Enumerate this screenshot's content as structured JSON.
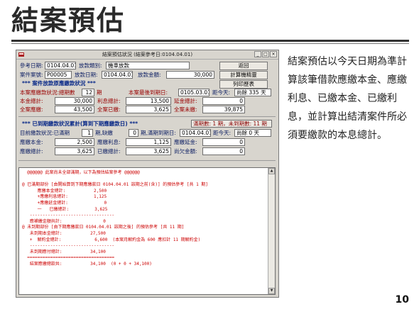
{
  "slide": {
    "title": "結案預估",
    "description": "結案預估以今天日期為準計算該筆借款應繳本金、應繳利息、已繳本金、已繳利息，並計算出結清案件所必須要繳款的本息總計。",
    "page_number": "10"
  },
  "window": {
    "title": "結案預估狀況 (結案參考日:0104.04.01)",
    "icon": "app-icon",
    "controls": [
      "_",
      "□",
      "×"
    ]
  },
  "form": {
    "ref_date_label": "參考日期:",
    "ref_date": "0104.04.01",
    "loan_type_label": "放款類別:",
    "loan_type": "機車放款",
    "case_no_label": "案件案號:",
    "case_no": "P00005",
    "loan_date_label": "放款日期:",
    "loan_date": "0104.04.01",
    "loan_amount_label": "放款金額:",
    "loan_amount": "30,000",
    "buttons": {
      "back": "返回",
      "calc_table": "計算機精靈",
      "print_detail": "列印歷表"
    },
    "sec1_title": "*** 案件放款原應繳款狀況 ***",
    "periods_label": "本案應繳款狀況:總期數",
    "periods": "12",
    "periods_unit": "期",
    "last_due_label": "本案最後到期日:",
    "last_due": "0105.03.01",
    "distance_label": "距今天:",
    "distance": "尚餘 335 天",
    "principal_total_label": "本金總計:",
    "principal_total": "30,000",
    "interest_total_label": "利息總計:",
    "interest_total": "13,500",
    "late_fee_total_label": "延金總計:",
    "late_fee_total": "0",
    "all_due_label": "全案應繳:",
    "all_due": "43,500",
    "all_paid_label": "全案已繳:",
    "all_paid": "3,625",
    "all_unpaid_label": "全案未繳:",
    "all_unpaid": "39,875",
    "sec2_title": "*** 已到期繳款狀況累計(算到下期應繳款日) ***",
    "sec2_status": "滿期數: 1 期，未到期數: 11 期",
    "pay_status_label": "目前繳款狀況:已滿期",
    "pay_full": "1",
    "pay_full_unit": "期,缺繳",
    "pay_missing": "0",
    "pay_missing_unit": "期,滿期到期日:",
    "full_due_date": "0104.04.01",
    "full_distance_label": "距今天:",
    "full_distance": "尚餘 0 天",
    "due_principal_label": "應繳本金:",
    "due_principal": "2,500",
    "due_interest_label": "應繳利息:",
    "due_interest": "1,125",
    "due_late_label": "應繳延金:",
    "due_late": "0",
    "paid_total_label": "應繳總計:",
    "paid_total": "3,625",
    "already_paid_label": "已繳總計:",
    "already_paid": "3,625",
    "owed_total_label": "尚欠金額:",
    "owed_total": "0"
  },
  "report": {
    "text": "  @@@@@@ 此案尚未全部滿期，以下為預估結案參考 @@@@@@\n\n@ 已滿期部份 [由開始算到下期應繳款日 0104.04.01 該期之前(含)] 的預估參考 [共 1 期]\n      應繳本金總計:           2,500\n      +應繳利息總計:          1,125\n      +應繳延金總計:              0\n      一   已繳總計:          3,625\n   ---------------------------------\n   應補繳金額共計:                0\n@ 未到期部份 [由下期應繳款日 0104.04.01 該期之後] 的預估參考 [共 11 期]\n   未到期本金總計:           27,500\n   +  解約金總計:             6,600  (本案月解約金為 600 應扣計 11 期解約金)\n   ---------------------------------\n   未到期應付總計:           34,100\n  ==================================\n   結案應繳總款共:           34,100  (0 + 0 + 34,100)"
  }
}
